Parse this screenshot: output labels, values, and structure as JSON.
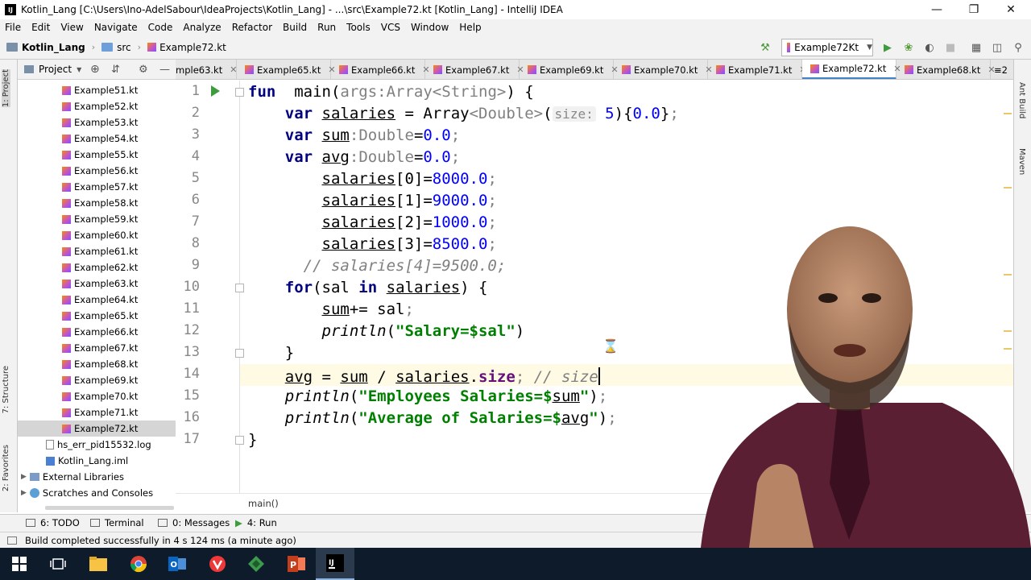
{
  "window": {
    "title": "Kotlin_Lang [C:\\Users\\Ino-AdelSabour\\IdeaProjects\\Kotlin_Lang] - ...\\src\\Example72.kt [Kotlin_Lang] - IntelliJ IDEA",
    "app_icon_text": "IJ"
  },
  "menu": [
    "File",
    "Edit",
    "View",
    "Navigate",
    "Code",
    "Analyze",
    "Refactor",
    "Build",
    "Run",
    "Tools",
    "VCS",
    "Window",
    "Help"
  ],
  "nav": {
    "breadcrumbs": [
      "Kotlin_Lang",
      "src",
      "Example72.kt"
    ],
    "run_config": "Example72Kt"
  },
  "project_panel": {
    "title": "Project",
    "items": [
      {
        "label": "Example51.kt",
        "type": "kt"
      },
      {
        "label": "Example52.kt",
        "type": "kt"
      },
      {
        "label": "Example53.kt",
        "type": "kt"
      },
      {
        "label": "Example54.kt",
        "type": "kt"
      },
      {
        "label": "Example55.kt",
        "type": "kt"
      },
      {
        "label": "Example56.kt",
        "type": "kt"
      },
      {
        "label": "Example57.kt",
        "type": "kt"
      },
      {
        "label": "Example58.kt",
        "type": "kt"
      },
      {
        "label": "Example59.kt",
        "type": "kt"
      },
      {
        "label": "Example60.kt",
        "type": "kt"
      },
      {
        "label": "Example61.kt",
        "type": "kt"
      },
      {
        "label": "Example62.kt",
        "type": "kt"
      },
      {
        "label": "Example63.kt",
        "type": "kt"
      },
      {
        "label": "Example64.kt",
        "type": "kt"
      },
      {
        "label": "Example65.kt",
        "type": "kt"
      },
      {
        "label": "Example66.kt",
        "type": "kt"
      },
      {
        "label": "Example67.kt",
        "type": "kt"
      },
      {
        "label": "Example68.kt",
        "type": "kt"
      },
      {
        "label": "Example69.kt",
        "type": "kt"
      },
      {
        "label": "Example70.kt",
        "type": "kt"
      },
      {
        "label": "Example71.kt",
        "type": "kt"
      },
      {
        "label": "Example72.kt",
        "type": "kt",
        "selected": true
      },
      {
        "label": "hs_err_pid15532.log",
        "type": "log"
      },
      {
        "label": "Kotlin_Lang.iml",
        "type": "iml"
      },
      {
        "label": "External Libraries",
        "type": "lib"
      },
      {
        "label": "Scratches and Consoles",
        "type": "scratch"
      }
    ]
  },
  "tabs": [
    {
      "label": "mple63.kt",
      "active": false
    },
    {
      "label": "Example65.kt",
      "active": false
    },
    {
      "label": "Example66.kt",
      "active": false
    },
    {
      "label": "Example67.kt",
      "active": false
    },
    {
      "label": "Example69.kt",
      "active": false
    },
    {
      "label": "Example70.kt",
      "active": false
    },
    {
      "label": "Example71.kt",
      "active": false
    },
    {
      "label": "Example72.kt",
      "active": true
    },
    {
      "label": "Example68.kt",
      "active": false
    },
    {
      "label": "≡2",
      "active": false
    }
  ],
  "editor": {
    "current_line": 14,
    "hint_size": "size:",
    "breadcrumb": "main()",
    "lines": [
      {
        "n": "1",
        "indent": "",
        "tokens": [
          [
            "kw",
            "fun"
          ],
          [
            "",
            "  "
          ],
          [
            "",
            "main("
          ],
          [
            "gray",
            "args:Array<String>"
          ],
          [
            "",
            ") {"
          ]
        ]
      },
      {
        "n": "2",
        "indent": "    ",
        "tokens": [
          [
            "kw",
            "var"
          ],
          [
            "",
            " "
          ],
          [
            "ul",
            "salaries"
          ],
          [
            "",
            " = Array"
          ],
          [
            "gray",
            "<Double>"
          ],
          [
            "",
            "("
          ],
          [
            "hint",
            "size:"
          ],
          [
            "",
            " "
          ],
          [
            "num",
            "5"
          ],
          [
            "",
            ")"
          ],
          [
            "",
            "{"
          ],
          [
            "num",
            "0.0"
          ],
          [
            "",
            "}"
          ],
          [
            "gray",
            ";"
          ]
        ]
      },
      {
        "n": "3",
        "indent": "    ",
        "tokens": [
          [
            "kw",
            "var"
          ],
          [
            "",
            " "
          ],
          [
            "ul",
            "sum"
          ],
          [
            "gray",
            ":Double"
          ],
          [
            "",
            "="
          ],
          [
            "num",
            "0.0"
          ],
          [
            "gray",
            ";"
          ]
        ]
      },
      {
        "n": "4",
        "indent": "    ",
        "tokens": [
          [
            "kw",
            "var"
          ],
          [
            "",
            " "
          ],
          [
            "ul",
            "avg"
          ],
          [
            "gray",
            ":Double"
          ],
          [
            "",
            "="
          ],
          [
            "num",
            "0.0"
          ],
          [
            "gray",
            ";"
          ]
        ]
      },
      {
        "n": "5",
        "indent": "        ",
        "tokens": [
          [
            "ul",
            "salaries"
          ],
          [
            "",
            "[0]="
          ],
          [
            "num",
            "8000.0"
          ],
          [
            "gray",
            ";"
          ]
        ]
      },
      {
        "n": "6",
        "indent": "        ",
        "tokens": [
          [
            "ul",
            "salaries"
          ],
          [
            "",
            "[1]="
          ],
          [
            "num",
            "9000.0"
          ],
          [
            "gray",
            ";"
          ]
        ]
      },
      {
        "n": "7",
        "indent": "        ",
        "tokens": [
          [
            "ul",
            "salaries"
          ],
          [
            "",
            "[2]="
          ],
          [
            "num",
            "1000.0"
          ],
          [
            "gray",
            ";"
          ]
        ]
      },
      {
        "n": "8",
        "indent": "        ",
        "tokens": [
          [
            "ul",
            "salaries"
          ],
          [
            "",
            "[3]="
          ],
          [
            "num",
            "8500.0"
          ],
          [
            "gray",
            ";"
          ]
        ]
      },
      {
        "n": "9",
        "indent": "      ",
        "tokens": [
          [
            "cmt",
            "// salaries[4]=9500.0;"
          ]
        ]
      },
      {
        "n": "10",
        "indent": "    ",
        "tokens": [
          [
            "kw",
            "for"
          ],
          [
            "",
            "(sal "
          ],
          [
            "kw",
            "in"
          ],
          [
            "",
            " "
          ],
          [
            "ul",
            "salaries"
          ],
          [
            "",
            ") {"
          ]
        ]
      },
      {
        "n": "11",
        "indent": "        ",
        "tokens": [
          [
            "ul",
            "sum"
          ],
          [
            "",
            "+= sal"
          ],
          [
            "gray",
            ";"
          ]
        ]
      },
      {
        "n": "12",
        "indent": "        ",
        "tokens": [
          [
            "it",
            "println"
          ],
          [
            "",
            "("
          ],
          [
            "str",
            "\"Salary=$sal\""
          ],
          [
            "",
            ")"
          ]
        ]
      },
      {
        "n": "13",
        "indent": "    ",
        "tokens": [
          [
            "",
            "}"
          ]
        ]
      },
      {
        "n": "14",
        "indent": "    ",
        "tokens": [
          [
            "ul",
            "avg"
          ],
          [
            "",
            " = "
          ],
          [
            "ul",
            "sum"
          ],
          [
            "",
            " / "
          ],
          [
            "ul",
            "salaries"
          ],
          [
            "",
            "."
          ],
          [
            "prp",
            "size"
          ],
          [
            "gray",
            ";"
          ],
          [
            "cmt",
            " // size"
          ]
        ]
      },
      {
        "n": "15",
        "indent": "    ",
        "tokens": [
          [
            "it",
            "println"
          ],
          [
            "",
            "("
          ],
          [
            "str",
            "\"Employees Salaries=$"
          ],
          [
            "ul",
            "sum"
          ],
          [
            "str",
            "\""
          ],
          [
            "",
            ")"
          ],
          [
            "gray",
            ";"
          ]
        ]
      },
      {
        "n": "16",
        "indent": "    ",
        "tokens": [
          [
            "it",
            "println"
          ],
          [
            "",
            "("
          ],
          [
            "str",
            "\"Average of Salaries=$"
          ],
          [
            "ul",
            "avg"
          ],
          [
            "str",
            "\""
          ],
          [
            "",
            ")"
          ],
          [
            "gray",
            ";"
          ]
        ]
      },
      {
        "n": "17",
        "indent": "",
        "tokens": [
          [
            "",
            "}"
          ]
        ]
      }
    ]
  },
  "left_stripe": [
    "1: Project",
    "7: Structure",
    "2: Favorites"
  ],
  "right_stripe": [
    "Ant Build",
    "Maven"
  ],
  "bottom_tools": [
    "6: TODO",
    "Terminal",
    "0: Messages",
    "4: Run"
  ],
  "status": "Build completed successfully in 4 s 124 ms (a minute ago)",
  "taskbar": [
    "windows-start",
    "task-view",
    "file-explorer",
    "chrome",
    "outlook",
    "vivaldi",
    "app-green",
    "powerpoint",
    "intellij"
  ],
  "colors": {
    "accent": "#4083c9",
    "keyword": "#000080",
    "number": "#0000ff",
    "string": "#008000",
    "comment": "#808080",
    "run_green": "#3e9b3e"
  }
}
